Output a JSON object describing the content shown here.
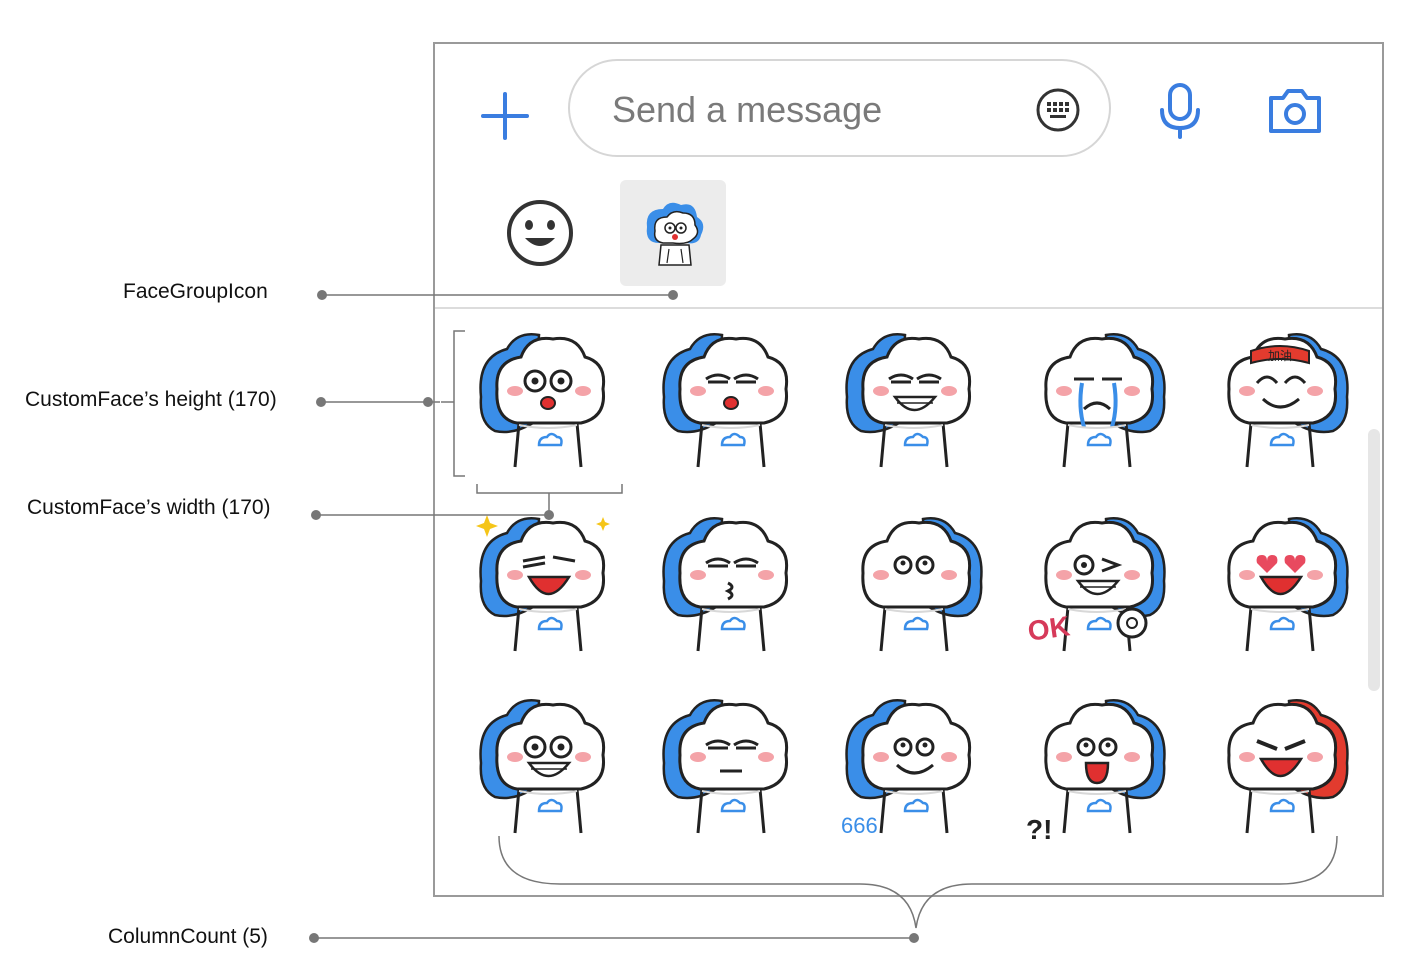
{
  "input_bar": {
    "placeholder": "Send a message",
    "plus_icon": "plus-icon",
    "keyboard_icon": "keyboard-icon",
    "mic_icon": "microphone-icon",
    "camera_icon": "camera-icon",
    "accent_color": "#3a7de0"
  },
  "face_tabs": [
    {
      "icon": "smiley-icon",
      "selected": false
    },
    {
      "icon": "cloud-mascot-icon",
      "selected": true
    }
  ],
  "stickers": [
    {
      "icon": "mascot-surprised-sticker"
    },
    {
      "icon": "mascot-thumbsup-sticker"
    },
    {
      "icon": "mascot-grin-sticker"
    },
    {
      "icon": "mascot-crying-sticker"
    },
    {
      "icon": "mascot-cheer-sticker"
    },
    {
      "icon": "mascot-laughing-sticker"
    },
    {
      "icon": "mascot-kiss-sticker"
    },
    {
      "icon": "mascot-stare-sticker"
    },
    {
      "icon": "mascot-ok-sticker"
    },
    {
      "icon": "mascot-heart-eyes-sticker"
    },
    {
      "icon": "mascot-big-smile-sticker"
    },
    {
      "icon": "mascot-eyeroll-sticker"
    },
    {
      "icon": "mascot-666-sticker"
    },
    {
      "icon": "mascot-question-sticker"
    },
    {
      "icon": "mascot-angry-sticker"
    }
  ],
  "sticker_texts": {
    "cheer_band": "加油",
    "ok": "OK",
    "six": "666",
    "question": "?!"
  },
  "annotations": {
    "face_group_icon": "FaceGroupIcon",
    "face_height": "CustomFace’s height (170)",
    "face_width": "CustomFace’s width (170)",
    "column_count": "ColumnCount (5)"
  }
}
